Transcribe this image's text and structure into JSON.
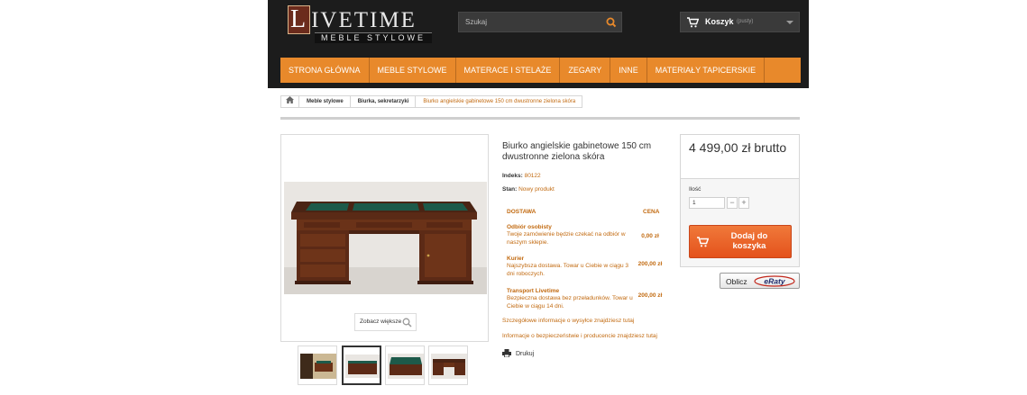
{
  "header": {
    "logo": {
      "initial": "L",
      "rest": "IVETIME",
      "tagline": "MEBLE STYLOWE"
    },
    "search": {
      "placeholder": "Szukaj",
      "icon": "search-icon"
    },
    "cart": {
      "label": "Koszyk",
      "status": "(pusty)",
      "icon": "cart-icon"
    }
  },
  "nav": {
    "items": [
      {
        "label": "STRONA GŁÓWNA"
      },
      {
        "label": "MEBLE STYLOWE"
      },
      {
        "label": "MATERACE I STELAŻE"
      },
      {
        "label": "ZEGARY"
      },
      {
        "label": "INNE"
      },
      {
        "label": "MATERIAŁY TAPICERSKIE"
      }
    ]
  },
  "breadcrumb": {
    "home_icon": "home-icon",
    "items": [
      {
        "label": "Meble stylowe"
      },
      {
        "label": "Biurka, sekretarzyki"
      },
      {
        "label": "Biurko angielskie gabinetowe 150 cm dwustronne zielona skóra"
      }
    ]
  },
  "gallery": {
    "zoom_label": "Zobacz większe",
    "thumbnail_count": 4,
    "active_thumbnail": 2
  },
  "product": {
    "title": "Biurko angielskie gabinetowe 150 cm dwustronne zielona skóra",
    "index_label": "Indeks:",
    "index_value": "80122",
    "state_label": "Stan:",
    "state_value": "Nowy produkt"
  },
  "shipping": {
    "col_delivery": "DOSTAWA",
    "col_price": "CENA",
    "options": [
      {
        "name": "Odbiór osobisty",
        "desc": "Twoje zamówienie będzie czekać na odbiór w naszym sklepie.",
        "price": "0,00 zł"
      },
      {
        "name": "Kurier",
        "desc": "Najszybsza dostawa. Towar u Ciebie w ciągu 3 dni roboczych.",
        "price": "200,00 zł"
      },
      {
        "name": "Transport Livetime",
        "desc": "Bezpieczna dostawa bez przeładunków. Towar u Ciebie w ciągu 14 dni.",
        "price": "200,00 zł"
      }
    ],
    "details_link": "Szczegółowe informacje o wysyłce znajdziesz tutaj",
    "safety_link": "Informacje o bezpieczeństwie i producencie znajdziesz tutaj",
    "print_label": "Drukuj"
  },
  "buy": {
    "price": "4 499,00 zł brutto",
    "qty_label": "Ilość",
    "qty_value": "1",
    "minus": "−",
    "plus": "+",
    "add_label": "Dodaj do koszyka",
    "calc_label": "Oblicz",
    "calc_brand": "eRaty",
    "accent": "#e8892b",
    "link_color": "#c26a10"
  }
}
